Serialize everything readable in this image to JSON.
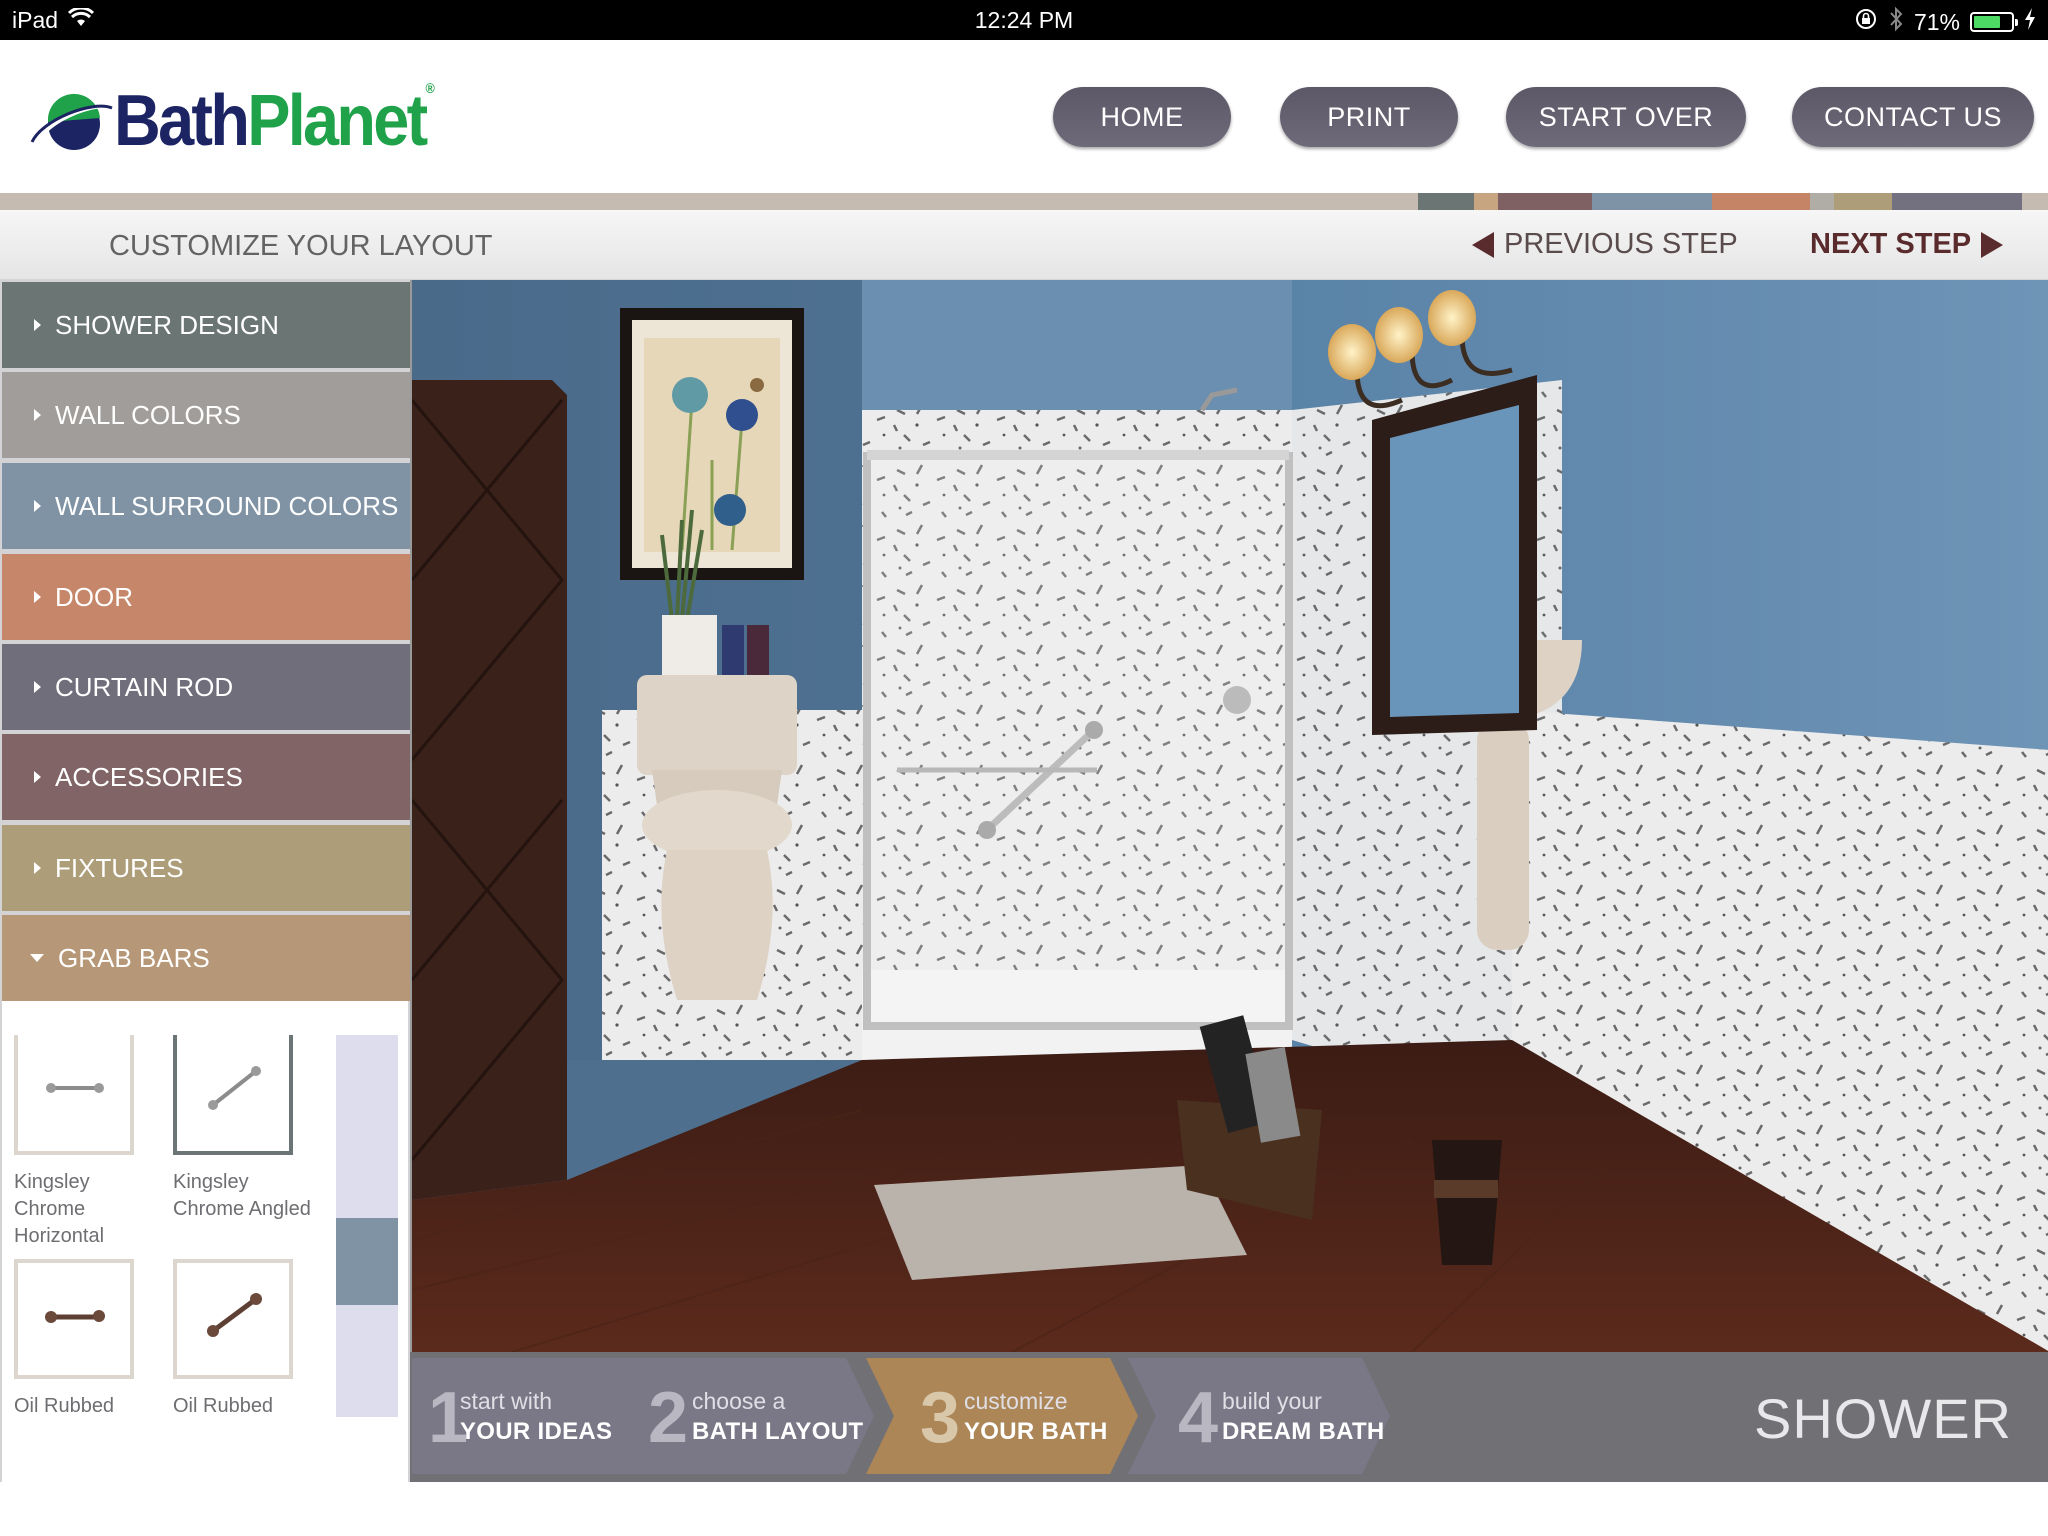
{
  "status_bar": {
    "device": "iPad",
    "time": "12:24 PM",
    "battery": "71%",
    "battery_level": 0.71,
    "icons": [
      "wifi-icon",
      "rotation-lock-icon",
      "bluetooth-icon",
      "battery-icon",
      "charging-bolt-icon"
    ]
  },
  "header": {
    "logo": {
      "part1": "Bath",
      "part2": "Planet",
      "reg": "®"
    },
    "nav": [
      {
        "label": "HOME"
      },
      {
        "label": "PRINT"
      },
      {
        "label": "START OVER"
      },
      {
        "label": "CONTACT US"
      }
    ],
    "stripe_colors": [
      "#6b7674",
      "#c6a580",
      "#7f6063",
      "#7e93a5",
      "#c68467",
      "#b0aca6",
      "#ad9d79",
      "#73717f"
    ]
  },
  "subheader": {
    "title": "CUSTOMIZE YOUR LAYOUT",
    "previous_step": "PREVIOUS STEP",
    "next_step": "NEXT STEP"
  },
  "sidebar": {
    "items": [
      {
        "label": "SHOWER DESIGN",
        "color": "#6b7674",
        "expanded": false
      },
      {
        "label": "WALL COLORS",
        "color": "#a19d9a",
        "expanded": false
      },
      {
        "label": "WALL SURROUND COLORS",
        "color": "#7f93a5",
        "expanded": false
      },
      {
        "label": "DOOR",
        "color": "#c6866a",
        "expanded": false
      },
      {
        "label": "CURTAIN ROD",
        "color": "#716e7b",
        "expanded": false
      },
      {
        "label": "ACCESSORIES",
        "color": "#806466",
        "expanded": false
      },
      {
        "label": "FIXTURES",
        "color": "#ad9d79",
        "expanded": false
      },
      {
        "label": "GRAB BARS",
        "color": "#b69878",
        "expanded": true
      }
    ],
    "grab_bar_options": [
      {
        "label": "Kingsley Chrome Horizontal",
        "finish": "chrome",
        "angle": "horizontal",
        "selected": false
      },
      {
        "label": "Kingsley Chrome Angled",
        "finish": "chrome",
        "angle": "angled",
        "selected": true
      },
      {
        "label": "Oil Rubbed",
        "finish": "oil-rubbed",
        "angle": "horizontal",
        "selected": false
      },
      {
        "label": "Oil Rubbed",
        "finish": "oil-rubbed",
        "angle": "angled",
        "selected": false
      }
    ],
    "scroll_position": 0.62
  },
  "steps": [
    {
      "number": "1",
      "small": "start with",
      "big": "YOUR IDEAS",
      "active": false
    },
    {
      "number": "2",
      "small": "choose a",
      "big": "BATH LAYOUT",
      "active": false
    },
    {
      "number": "3",
      "small": "customize",
      "big": "YOUR BATH",
      "active": true
    },
    {
      "number": "4",
      "small": "build your",
      "big": "DREAM BATH",
      "active": false
    }
  ],
  "mode_label": "SHOWER"
}
